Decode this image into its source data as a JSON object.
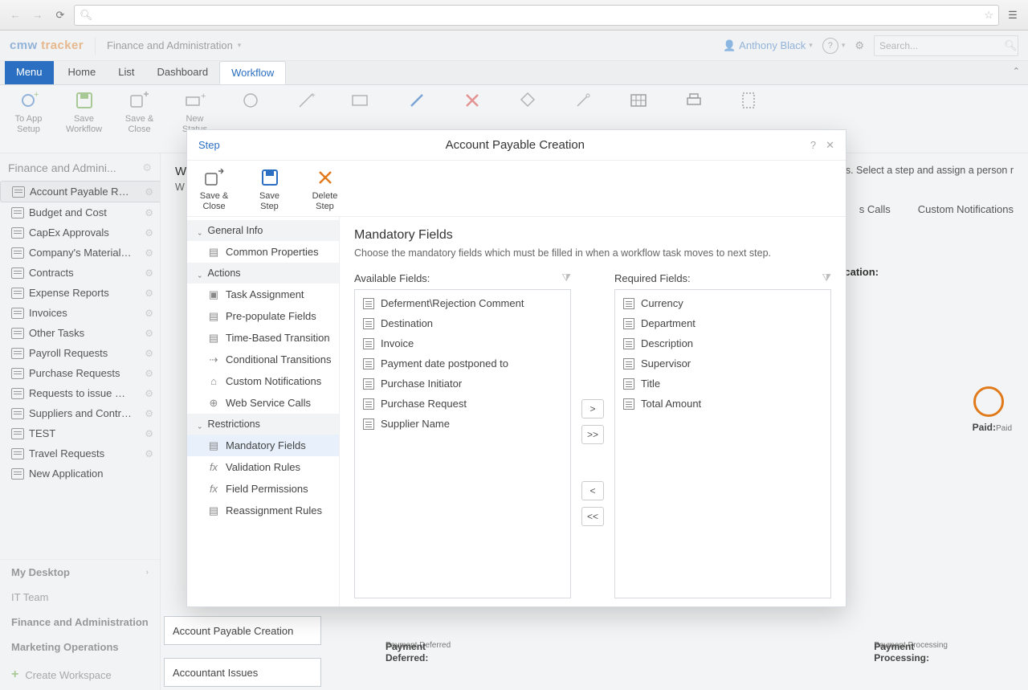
{
  "browser": {
    "url_hint": ""
  },
  "header": {
    "brand_a": "cmw",
    "brand_b": "tracker",
    "workspace": "Finance and Administration",
    "user": "Anthony Black",
    "search_placeholder": "Search..."
  },
  "tabs": {
    "menu": "Menu",
    "home": "Home",
    "list": "List",
    "dashboard": "Dashboard",
    "workflow": "Workflow"
  },
  "ribbon": [
    {
      "label": "To App Setup"
    },
    {
      "label": "Save Workflow"
    },
    {
      "label": "Save & Close"
    },
    {
      "label": "New Status"
    }
  ],
  "sidebar": {
    "title": "Finance and Admini...",
    "items": [
      "Account Payable Requ...",
      "Budget and Cost",
      "CapEx Approvals",
      "Company's Material A...",
      "Contracts",
      "Expense Reports",
      "Invoices",
      "Other Tasks",
      "Payroll Requests",
      "Purchase Requests",
      "Requests to issue Mat...",
      "Suppliers and Contrac...",
      "TEST",
      "Travel Requests",
      "New Application"
    ],
    "sections": [
      "My Desktop",
      "IT Team",
      "Finance and Administration",
      "Marketing Operations"
    ],
    "create": "Create Workspace"
  },
  "main_bg": {
    "heading_prefix": "W",
    "sub_prefix": "W",
    "sub_suffix": "tions. Select a step and assign a person r",
    "right_tabs": [
      "s Calls",
      "Custom Notifications"
    ],
    "right_side_label": "cation:",
    "paid_label": "Paid:",
    "paid_sub": "Paid",
    "pd_label": "Payment Deferred:",
    "pd_sub": "Payment Deferred",
    "pp_label": "Payment Processing:",
    "pp_sub": "Payment Processing",
    "steps": [
      "Account Payable Creation",
      "Accountant Issues"
    ]
  },
  "modal": {
    "crumb": "Step",
    "title": "Account Payable Creation",
    "ribbon": [
      {
        "l1": "Save &",
        "l2": "Close"
      },
      {
        "l1": "Save",
        "l2": "Step"
      },
      {
        "l1": "Delete",
        "l2": "Step"
      }
    ],
    "nav": {
      "g1": "General Info",
      "g1_items": [
        "Common Properties"
      ],
      "g2": "Actions",
      "g2_items": [
        "Task Assignment",
        "Pre-populate Fields",
        "Time-Based Transition",
        "Conditional Transitions",
        "Custom Notifications",
        "Web Service Calls"
      ],
      "g3": "Restrictions",
      "g3_items": [
        "Mandatory Fields",
        "Validation Rules",
        "Field Permissions",
        "Reassignment Rules"
      ]
    },
    "content": {
      "title": "Mandatory Fields",
      "sub": "Choose the mandatory fields which must be filled in when a workflow task moves to next step.",
      "avail_label": "Available Fields:",
      "req_label": "Required Fields:",
      "available": [
        "Deferment\\Rejection Comment",
        "Destination",
        "Invoice",
        "Payment date postponed to",
        "Purchase Initiator",
        "Purchase Request",
        "Supplier Name"
      ],
      "required": [
        "Currency",
        "Department",
        "Description",
        "Supervisor",
        "Title",
        "Total Amount"
      ],
      "btn_r": ">",
      "btn_rr": ">>",
      "btn_l": "<",
      "btn_ll": "<<"
    }
  }
}
